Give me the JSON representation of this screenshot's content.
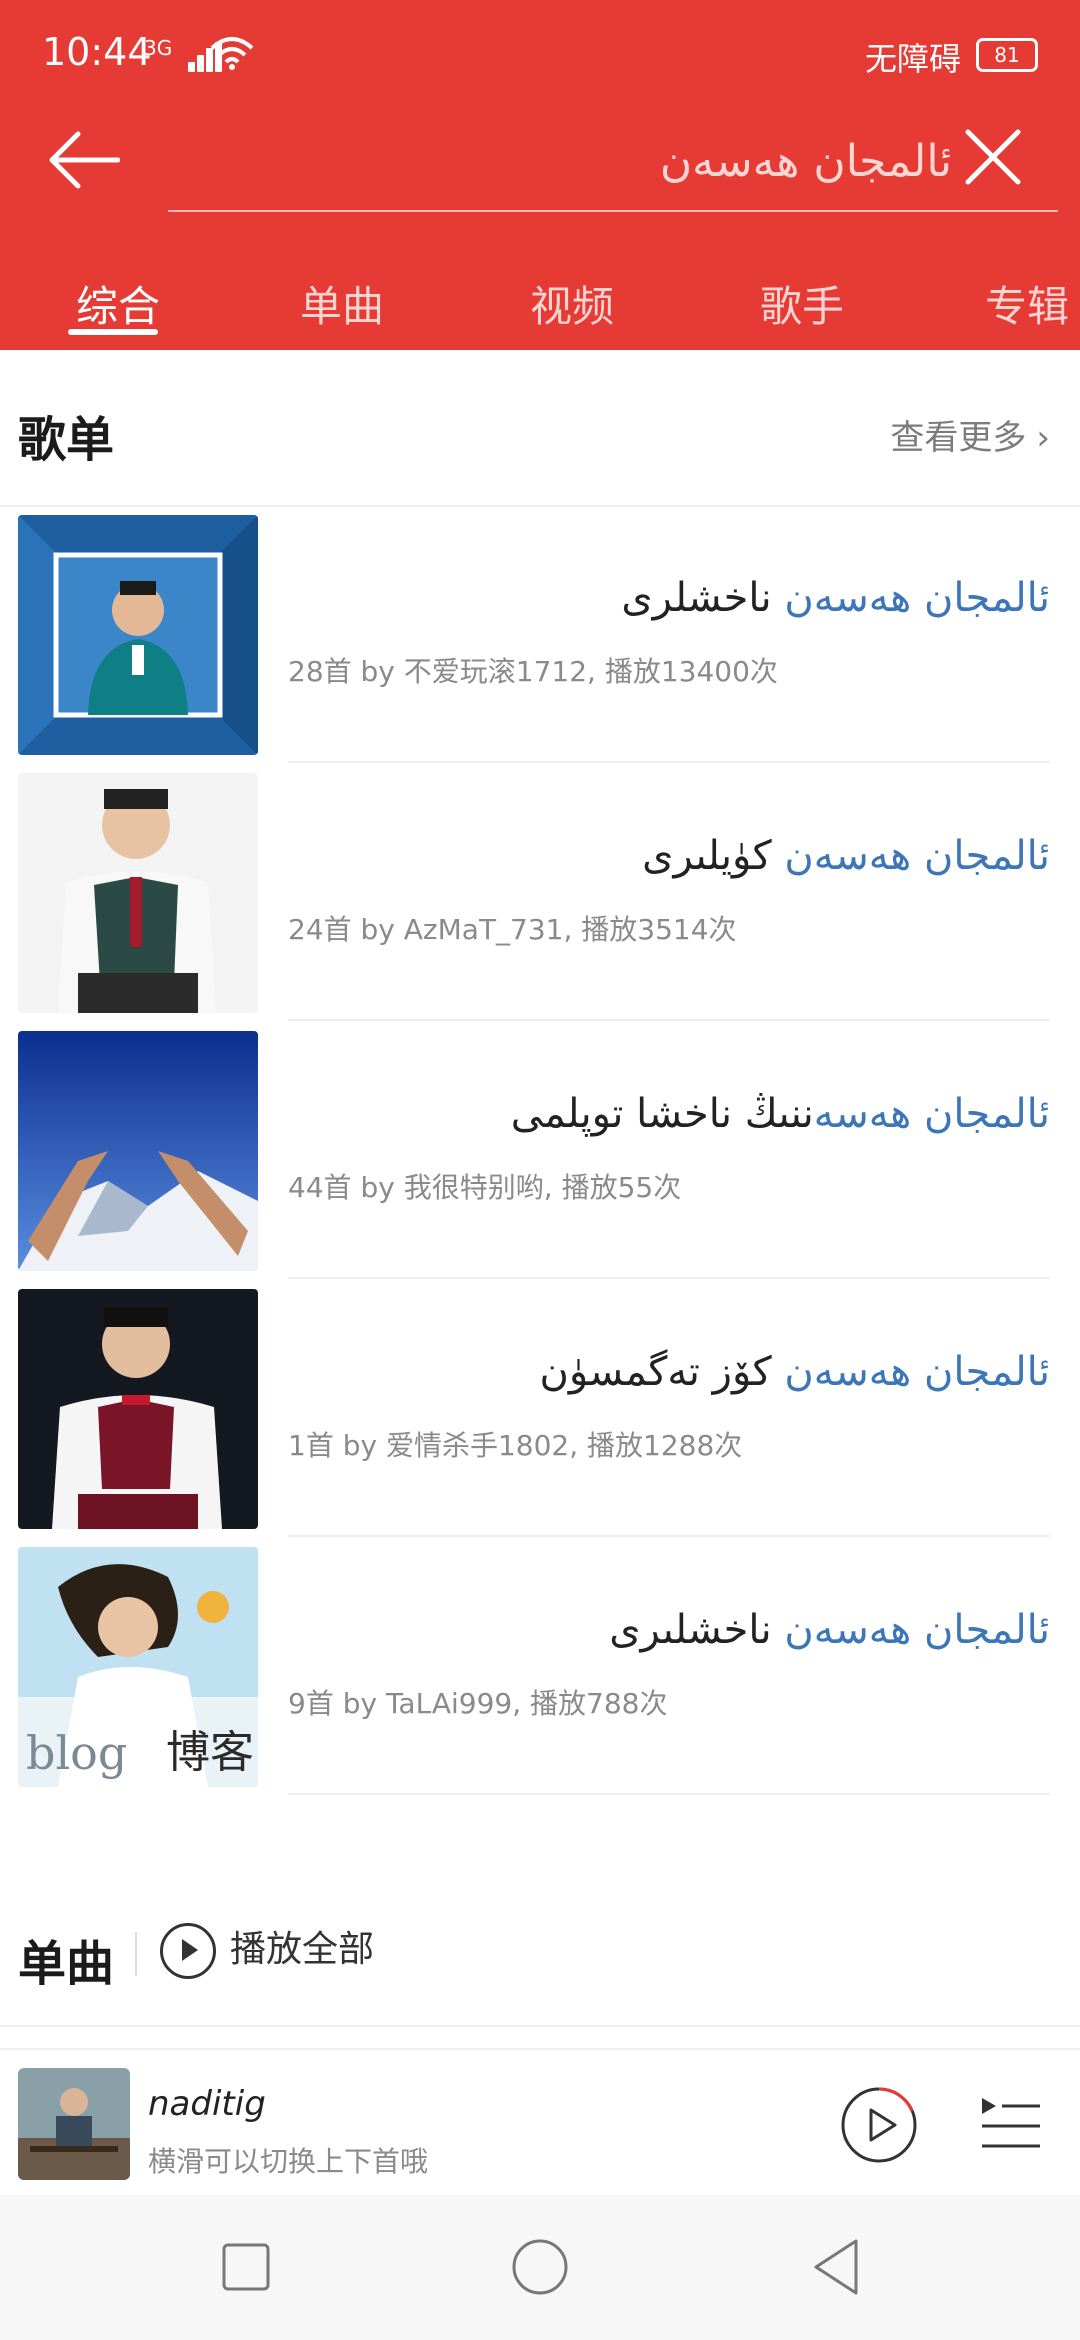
{
  "status_bar": {
    "time": "10:44",
    "network": "3G",
    "accessibility_label": "无障碍",
    "battery": "81"
  },
  "search": {
    "query": "ئالمجان ھەسەن"
  },
  "tabs": [
    {
      "label": "综合",
      "active": true
    },
    {
      "label": "单曲",
      "active": false
    },
    {
      "label": "视频",
      "active": false
    },
    {
      "label": "歌手",
      "active": false
    },
    {
      "label": "专辑",
      "active": false
    }
  ],
  "playlists_section": {
    "title": "歌单",
    "more_label": "查看更多"
  },
  "playlists": [
    {
      "title_highlight": "ئالمجان ھەسەن",
      "title_rest": " ناخشلرى",
      "meta": "28首  by 不爱玩滚1712, 播放13400次"
    },
    {
      "title_highlight": "ئالمجان ھەسەن",
      "title_rest": " كۈيلىرى",
      "meta": "24首  by AzMaT_731, 播放3514次"
    },
    {
      "title_highlight": "ئالمجان ھەسە",
      "title_rest": "ننىڭ ناخشا توپلمى",
      "meta": "44首  by 我很特别哟, 播放55次"
    },
    {
      "title_highlight": "ئالمجان ھەسەن",
      "title_rest": " كۆز تەگمسۈن",
      "meta": "1首  by 爱情杀手1802, 播放1288次"
    },
    {
      "title_highlight": "ئالمجان ھەسەن",
      "title_rest": " ناخشلىرى",
      "meta": "9首  by TaLAi999, 播放788次"
    }
  ],
  "singles_section": {
    "title": "单曲",
    "play_all_label": "播放全部"
  },
  "mini_player": {
    "track_title": "naditig",
    "hint": "横滑可以切换上下首哦"
  },
  "colors": {
    "header": "#e63a35",
    "highlight": "#3c76b6"
  }
}
